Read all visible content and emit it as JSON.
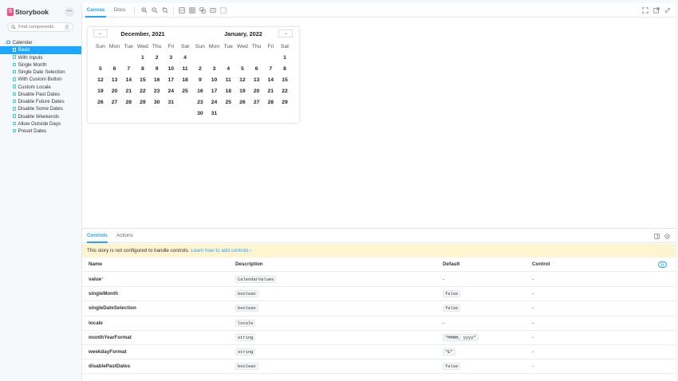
{
  "brand": {
    "name": "Storybook",
    "logo_letter": "S"
  },
  "sidebar": {
    "menu_icon": "ellipsis-icon",
    "search_placeholder": "Find components",
    "search_shortcut": "/",
    "group": "Calendar",
    "items": [
      {
        "label": "Basic",
        "selected": true
      },
      {
        "label": "With Inputs"
      },
      {
        "label": "Single Month"
      },
      {
        "label": "Single Date Selection"
      },
      {
        "label": "With Custom Button"
      },
      {
        "label": "Custom Locale"
      },
      {
        "label": "Disable Past Dates"
      },
      {
        "label": "Disable Future Dates"
      },
      {
        "label": "Disable Some Dates"
      },
      {
        "label": "Disable Weekends"
      },
      {
        "label": "Allow Outside Days"
      },
      {
        "label": "Preset Dates"
      }
    ]
  },
  "toolbar": {
    "tabs": [
      "Canvas",
      "Docs"
    ],
    "active_tab": "Canvas",
    "tools": [
      "zoom-in-icon",
      "zoom-out-icon",
      "zoom-reset-icon",
      "background-icon",
      "grid-icon",
      "measure-icon",
      "outline-icon",
      "viewport-icon"
    ],
    "right_tools": [
      "fullscreen-icon",
      "open-new-tab-icon",
      "copy-link-icon"
    ]
  },
  "calendar": {
    "prev_label": "←",
    "next_label": "→",
    "weekdays": [
      "Sun",
      "Mon",
      "Tue",
      "Wed",
      "Thu",
      "Fri",
      "Sat"
    ],
    "months": [
      {
        "title": "December, 2021",
        "weeks": [
          [
            "",
            "",
            "",
            "1",
            "2",
            "3",
            "4"
          ],
          [
            "5",
            "6",
            "7",
            "8",
            "9",
            "10",
            "11"
          ],
          [
            "12",
            "13",
            "14",
            "15",
            "16",
            "17",
            "18"
          ],
          [
            "19",
            "20",
            "21",
            "22",
            "23",
            "24",
            "25"
          ],
          [
            "26",
            "27",
            "28",
            "29",
            "30",
            "31",
            ""
          ]
        ]
      },
      {
        "title": "January, 2022",
        "weeks": [
          [
            "",
            "",
            "",
            "",
            "",
            "",
            "1"
          ],
          [
            "2",
            "3",
            "4",
            "5",
            "6",
            "7",
            "8"
          ],
          [
            "9",
            "10",
            "11",
            "12",
            "13",
            "14",
            "15"
          ],
          [
            "16",
            "17",
            "18",
            "19",
            "20",
            "21",
            "22"
          ],
          [
            "23",
            "24",
            "25",
            "26",
            "27",
            "28",
            "29"
          ],
          [
            "30",
            "31",
            "",
            "",
            "",
            "",
            ""
          ]
        ]
      }
    ]
  },
  "addons": {
    "tabs": [
      "Controls",
      "Actions"
    ],
    "active_tab": "Controls",
    "panel_icons": [
      "panel-toggle-icon",
      "close-icon"
    ],
    "notice_text": "This story is not configured to handle controls.",
    "notice_link": "Learn how to add controls ›",
    "columns": {
      "name": "Name",
      "description": "Description",
      "default": "Default",
      "control": "Control"
    },
    "reset_icon": "undo-icon",
    "rows": [
      {
        "name": "value",
        "required": true,
        "type": "CalendarValues",
        "default": "-",
        "default_is_code": false,
        "control": "-"
      },
      {
        "name": "singleMonth",
        "required": false,
        "type": "boolean",
        "default": "false",
        "default_is_code": true,
        "control": "-"
      },
      {
        "name": "singleDateSelection",
        "required": false,
        "type": "boolean",
        "default": "false",
        "default_is_code": true,
        "control": "-"
      },
      {
        "name": "locale",
        "required": false,
        "type": "locale",
        "default": "-",
        "default_is_code": false,
        "control": "-"
      },
      {
        "name": "monthYearFormat",
        "required": false,
        "type": "string",
        "default": "\"MMMM, yyyy\"",
        "default_is_code": true,
        "control": "-"
      },
      {
        "name": "weekdayFormat",
        "required": false,
        "type": "string",
        "default": "\"E\"",
        "default_is_code": true,
        "control": "-"
      },
      {
        "name": "disablePastDates",
        "required": false,
        "type": "boolean",
        "default": "false",
        "default_is_code": true,
        "control": "-"
      }
    ],
    "required_marker": "*"
  },
  "colors": {
    "accent": "#1ea7fd",
    "brand": "#ff4785",
    "notice_bg": "#fff4d0"
  }
}
